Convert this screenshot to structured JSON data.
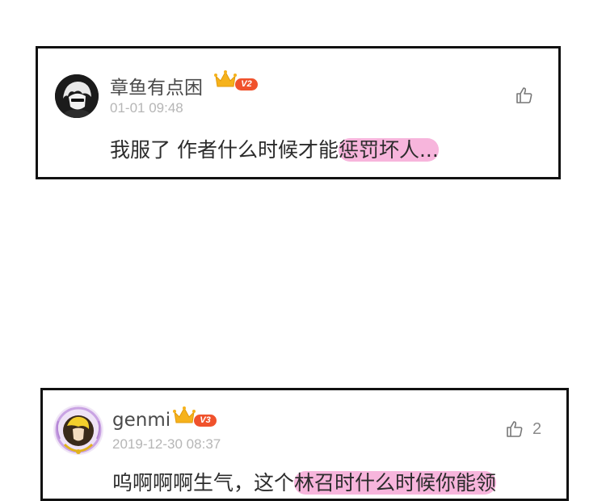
{
  "comments": [
    {
      "username": "章鱼有点困",
      "level": "V2",
      "timestamp": "01-01 09:48",
      "like_count": "",
      "text_plain": "我服了 作者什么时候才能",
      "text_highlight": "惩罚坏人...",
      "avatar": "white-haired-character-avatar"
    },
    {
      "username": "genmi",
      "level": "V3",
      "timestamp": "2019-12-30 08:37",
      "like_count": "2",
      "text_plain": "呜啊啊啊生气，这个",
      "text_highlight": "林召时什么时候你能领",
      "avatar": "framed-character-avatar"
    }
  ],
  "colors": {
    "highlight": "#f7b5dc",
    "level_badge": "#f0522c",
    "crown": "#f6b21b",
    "card_border": "#111111"
  }
}
